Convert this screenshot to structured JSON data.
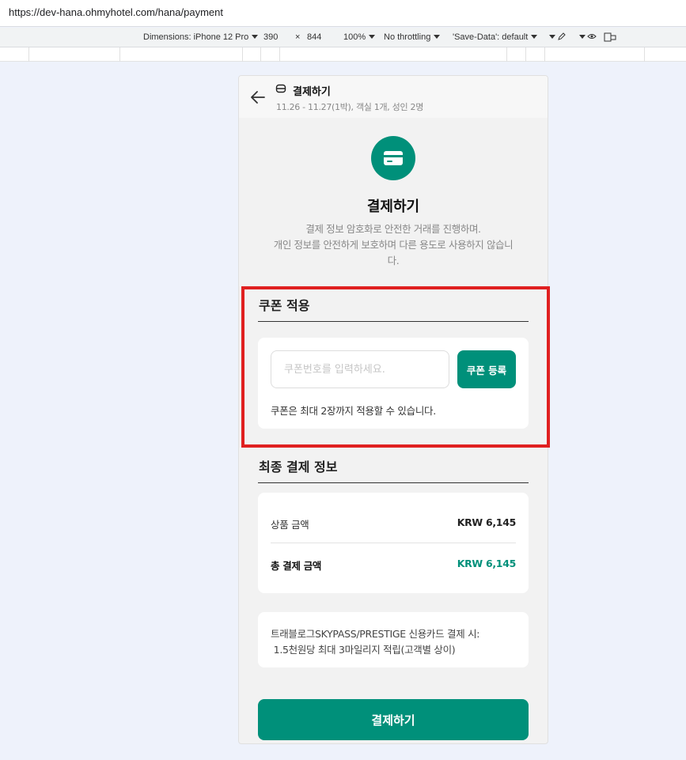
{
  "browser": {
    "url": "https://dev-hana.ohmyhotel.com/hana/payment"
  },
  "devtools": {
    "dimensions_label": "Dimensions: iPhone 12 Pro",
    "width": "390",
    "times": "×",
    "height": "844",
    "zoom": "100%",
    "throttling": "No throttling",
    "save_data": "'Save-Data': default"
  },
  "header": {
    "title": "결제하기",
    "subtitle": "11.26 - 11.27(1박), 객실 1개, 성인 2명"
  },
  "hero": {
    "title": "결제하기",
    "desc_line1": "결제 정보 암호화로 안전한 거래를 진행하며.",
    "desc_line2": "개인 정보를 안전하게 보호하며 다른 용도로 사용하지 않습니",
    "desc_line3": "다."
  },
  "coupon": {
    "section_title": "쿠폰 적용",
    "input_value": "",
    "input_placeholder": "쿠폰번호를 입력하세요.",
    "button_label": "쿠폰 등록",
    "note": "쿠폰은 최대 2장까지 적용할 수 있습니다."
  },
  "summary": {
    "section_title": "최종 결제 정보",
    "product_label": "상품 금액",
    "product_value": "KRW 6,145",
    "total_label": "총 결제 금액",
    "total_value": "KRW 6,145"
  },
  "promo": {
    "line1": "트래블로그SKYPASS/PRESTIGE 신용카드 결제 시:",
    "line2": " 1.5천원당 최대 3마일리지 적립(고객별 상이)"
  },
  "pay_button": {
    "label": "결제하기"
  },
  "colors": {
    "accent": "#00907a",
    "highlight": "#e02020"
  }
}
